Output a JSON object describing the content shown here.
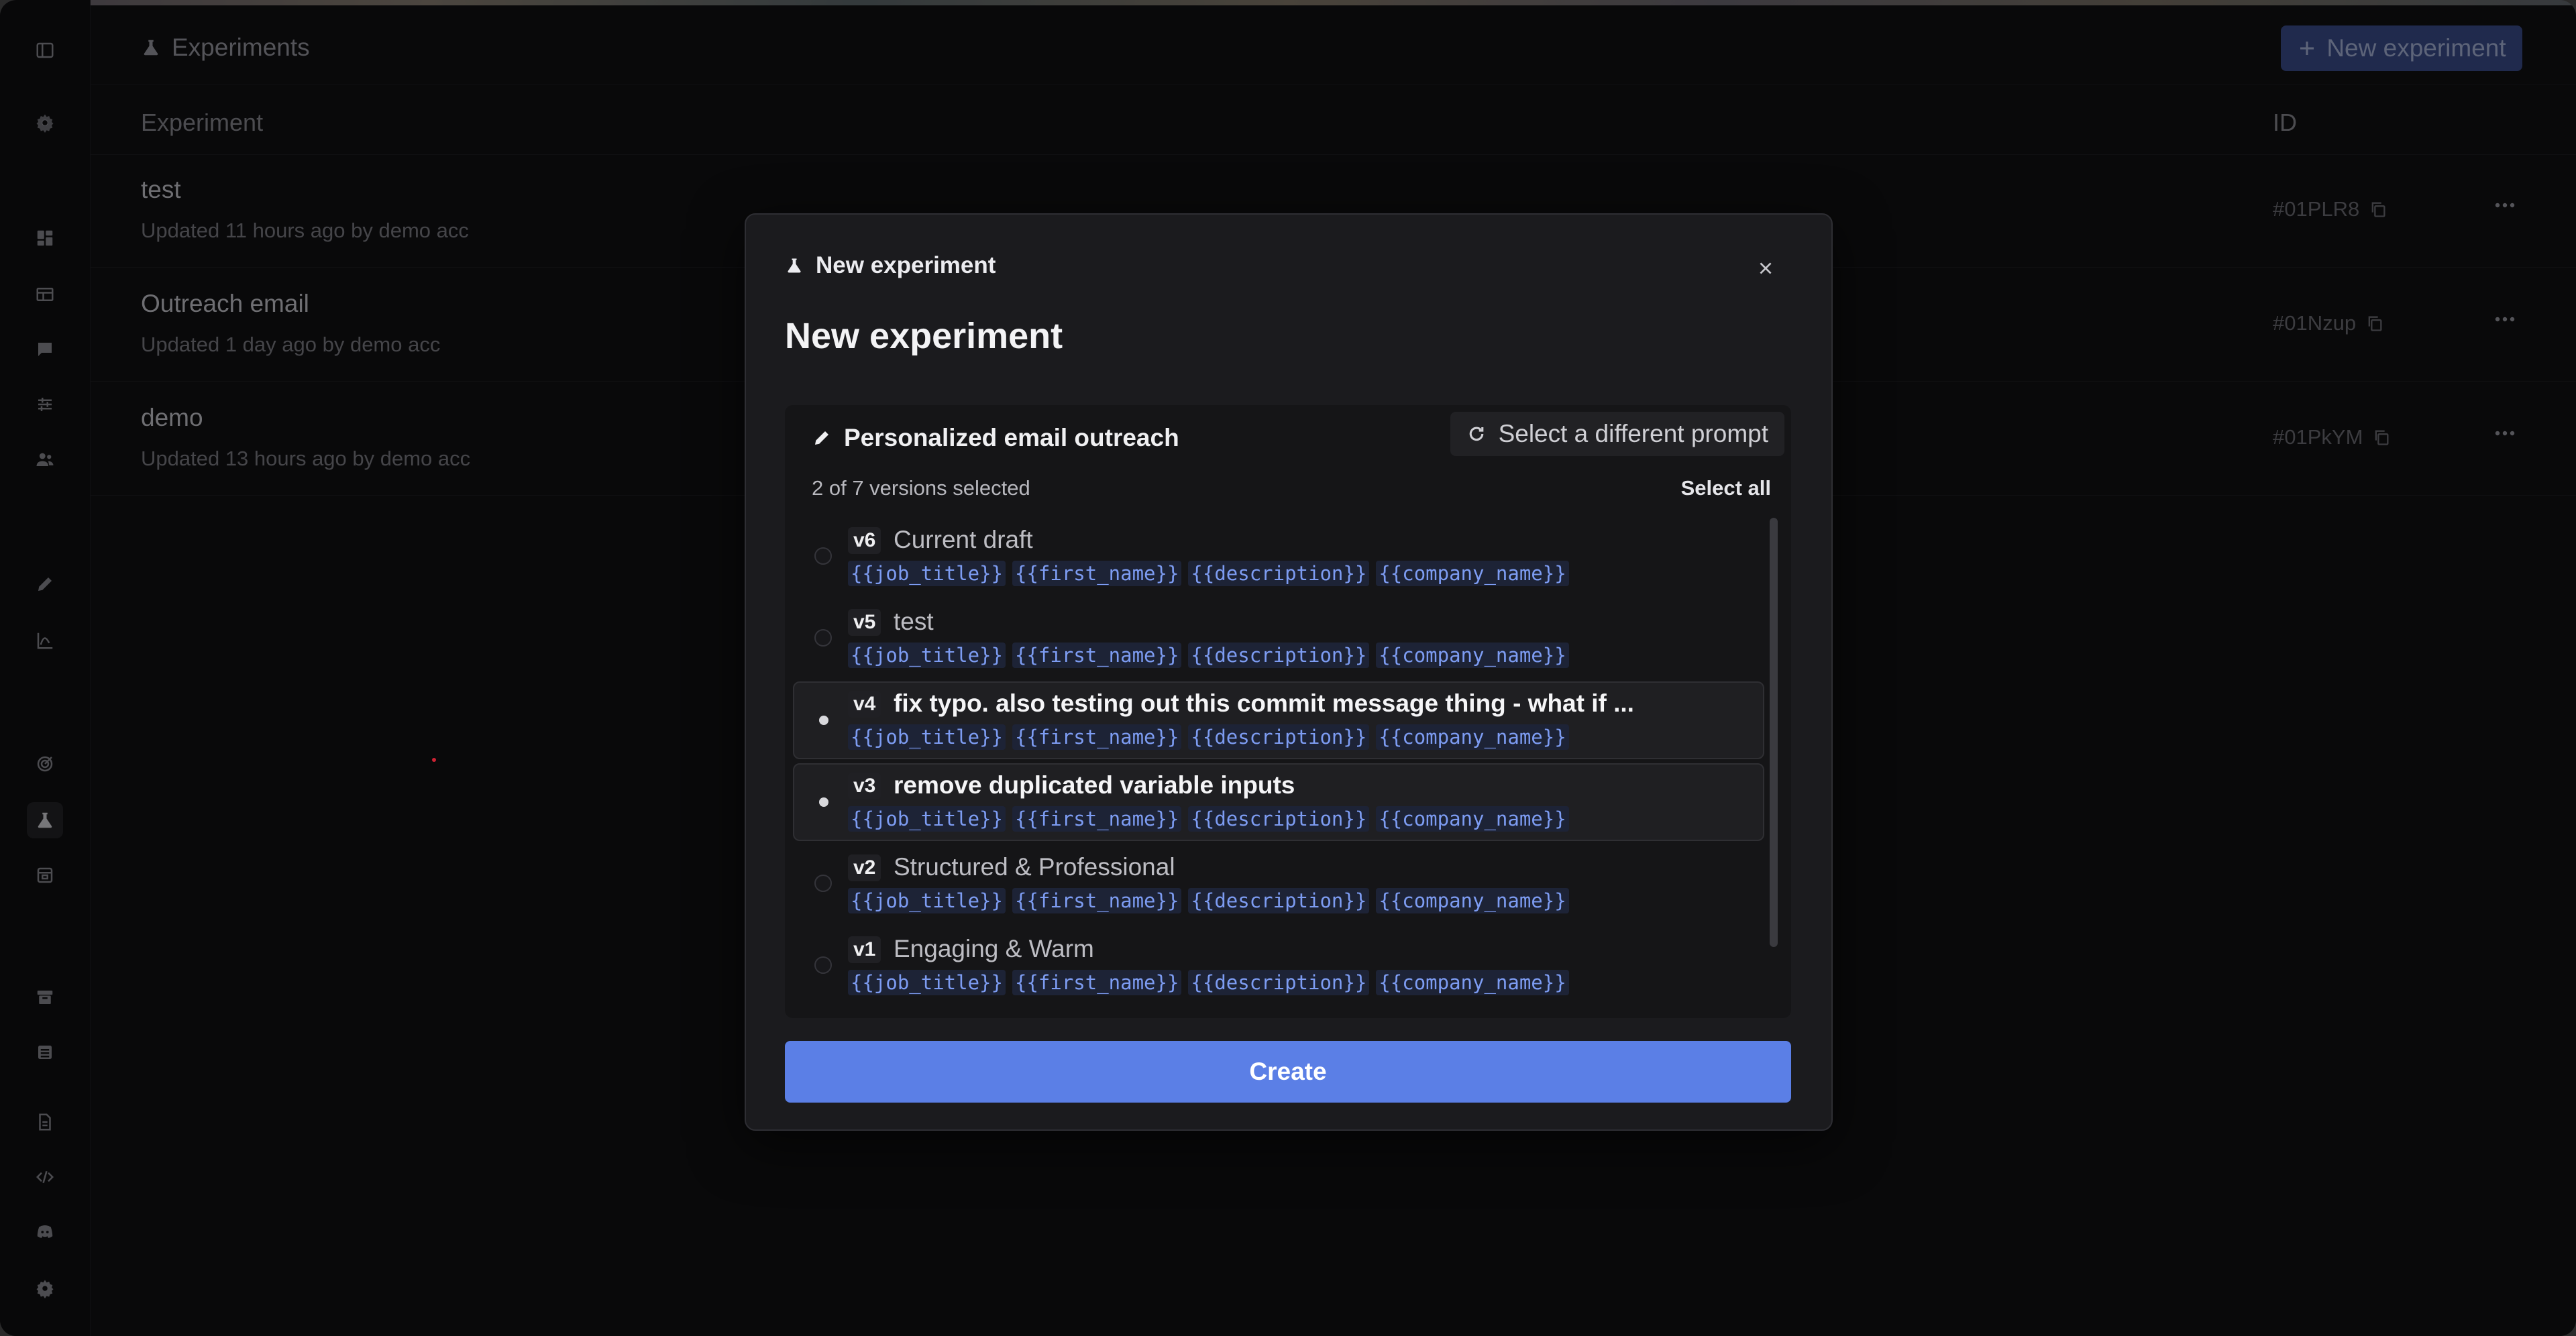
{
  "page": {
    "title": "Experiments",
    "new_button": "New experiment",
    "columns": {
      "experiment": "Experiment",
      "id": "ID"
    }
  },
  "experiments": [
    {
      "name": "test",
      "updated": "Updated 11 hours ago by demo acc",
      "id": "#01PLR8"
    },
    {
      "name": "Outreach email",
      "updated": "Updated 1 day ago by demo acc",
      "id": "#01Nzup"
    },
    {
      "name": "demo",
      "updated": "Updated 13 hours ago by demo acc",
      "id": "#01PkYM"
    }
  ],
  "modal": {
    "header": "New experiment",
    "title": "New experiment",
    "prompt_name": "Personalized email outreach",
    "switch_prompt": "Select a different prompt",
    "selection_count": "2 of 7 versions selected",
    "select_all": "Select all",
    "versions": [
      {
        "tag": "v6",
        "label": "Current draft",
        "selected": false,
        "vars": [
          "{{job_title}}",
          "{{first_name}}",
          "{{description}}",
          "{{company_name}}"
        ]
      },
      {
        "tag": "v5",
        "label": "test",
        "selected": false,
        "vars": [
          "{{job_title}}",
          "{{first_name}}",
          "{{description}}",
          "{{company_name}}"
        ]
      },
      {
        "tag": "v4",
        "label": "fix typo. also testing out this commit message thing - what if ...",
        "selected": true,
        "vars": [
          "{{job_title}}",
          "{{first_name}}",
          "{{description}}",
          "{{company_name}}"
        ]
      },
      {
        "tag": "v3",
        "label": "remove duplicated variable inputs",
        "selected": true,
        "vars": [
          "{{job_title}}",
          "{{first_name}}",
          "{{description}}",
          "{{company_name}}"
        ]
      },
      {
        "tag": "v2",
        "label": "Structured & Professional",
        "selected": false,
        "vars": [
          "{{job_title}}",
          "{{first_name}}",
          "{{description}}",
          "{{company_name}}"
        ]
      },
      {
        "tag": "v1",
        "label": "Engaging & Warm",
        "selected": false,
        "vars": [
          "{{job_title}}",
          "{{first_name}}",
          "{{description}}",
          "{{company_name}}"
        ]
      }
    ],
    "create_button": "Create"
  },
  "colors": {
    "accent": "#5b7fe6",
    "variable": "#7d9cf2",
    "background": "#111113"
  }
}
